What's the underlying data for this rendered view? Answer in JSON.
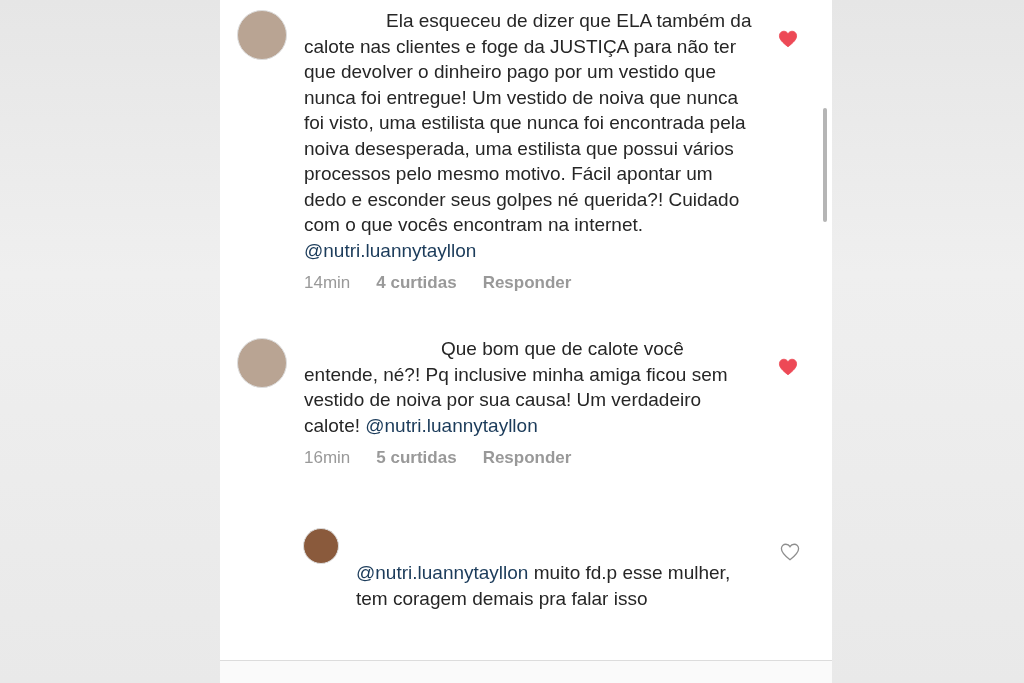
{
  "comments": [
    {
      "parts": [
        {
          "kind": "text",
          "text": "Ela esqueceu de dizer que ELA também da calote nas clientes e foge da JUSTIÇA para não ter que devolver o dinheiro pago por um vestido que nunca foi entregue! Um vestido de noiva que nunca foi visto, uma estilista que nunca foi encontrada pela noiva desesperada, uma estilista que possui vários processos pelo mesmo motivo. Fácil apontar um dedo e esconder seus golpes né querida?! Cuidado com o que vocês encontram na internet. "
        },
        {
          "kind": "mention",
          "text": "@nutri.luannytayllon"
        }
      ],
      "time": "14min",
      "likes": "4 curtidas",
      "reply": "Responder",
      "liked": true
    },
    {
      "parts": [
        {
          "kind": "text",
          "text": "Que bom que de calote você entende, né?! Pq inclusive minha amiga ficou sem vestido de noiva por sua causa! Um verdadeiro calote!  "
        },
        {
          "kind": "mention",
          "text": "@nutri.luannytayllon"
        }
      ],
      "time": "16min",
      "likes": "5 curtidas",
      "reply": "Responder",
      "liked": true,
      "children": [
        {
          "parts": [
            {
              "kind": "mention",
              "text": "@nutri.luannytayllon"
            },
            {
              "kind": "text",
              "text": "  muito fd.p esse mulher, tem coragem demais pra falar isso"
            }
          ],
          "liked": false
        }
      ]
    }
  ]
}
